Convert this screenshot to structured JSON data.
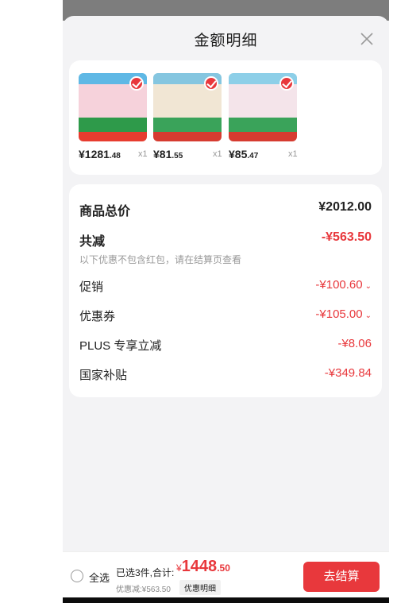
{
  "sheet": {
    "title": "金额明细"
  },
  "products": [
    {
      "price_main": "¥1281",
      "price_dec": ".48",
      "qty": "x1",
      "colors": [
        "#5fb8e5",
        "#f6d2db",
        "#2e9a4a",
        "#e73c2f"
      ]
    },
    {
      "price_main": "¥81",
      "price_dec": ".55",
      "qty": "x1",
      "colors": [
        "#85c6e0",
        "#f1e6d4",
        "#3aa35a",
        "#d63b30"
      ]
    },
    {
      "price_main": "¥85",
      "price_dec": ".47",
      "qty": "x1",
      "colors": [
        "#8dcfe8",
        "#f4e4ea",
        "#3aa35a",
        "#d63b30"
      ]
    }
  ],
  "summary": {
    "total_label": "商品总价",
    "total_value": "¥2012.00",
    "reduce_label": "共减",
    "reduce_value": "-¥563.50",
    "note": "以下优惠不包含红包，请在结算页查看",
    "items": [
      {
        "label": "促销",
        "value": "-¥100.60",
        "caret": "⌄"
      },
      {
        "label": "优惠券",
        "value": "-¥105.00",
        "caret": "⌄"
      },
      {
        "label": "PLUS 专享立减",
        "value": "-¥8.06",
        "caret": ""
      },
      {
        "label": "国家补贴",
        "value": "-¥349.84",
        "caret": ""
      }
    ]
  },
  "bottom": {
    "select_all": "全选",
    "selected_text": "已选3件,合计:",
    "yen": "¥",
    "total_int": "1448",
    "total_dec": ".50",
    "discount": "优惠减:¥563.50",
    "detail_btn": "优惠明细",
    "checkout": "去结算"
  }
}
